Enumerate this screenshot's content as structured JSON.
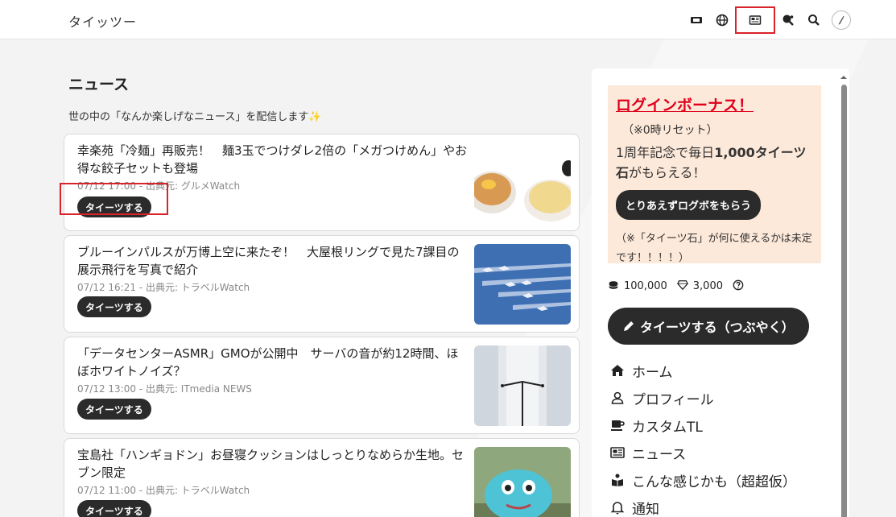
{
  "header": {
    "brand": "タイッツー",
    "icons": [
      "ticket-icon",
      "globe-icon",
      "newspaper-icon",
      "pingpong-icon",
      "search-icon",
      "avatar"
    ]
  },
  "main": {
    "title": "ニュース",
    "subtitle": "世の中の「なんか楽しげなニュース」を配信します✨",
    "articles": [
      {
        "title": "幸楽苑「冷麺」再販売！　麺3玉でつけダレ2倍の「メガつけめん」やお得な餃子セットも登場",
        "meta": "07/12 17:00 - 出典元: グルメWatch",
        "button": "タイーツする"
      },
      {
        "title": "ブルーインパルスが万博上空に来たぞ！　大屋根リングで見た7課目の展示飛行を写真で紹介",
        "meta": "07/12 16:21 - 出典元: トラベルWatch",
        "button": "タイーツする"
      },
      {
        "title": "「データセンターASMR」GMOが公開中　サーバの音が約12時間、ほぼホワイトノイズ？",
        "meta": "07/12 13:00 - 出典元: ITmedia NEWS",
        "button": "タイーツする"
      },
      {
        "title": "宝島社「ハンギョドン」お昼寝クッションはしっとりなめらか生地。セブン限定",
        "meta": "07/12 11:00 - 出典元: トラベルWatch",
        "button": "タイーツする"
      }
    ]
  },
  "sidebar": {
    "bonus": {
      "title": "ログインボーナス！",
      "note": "（※0時リセット）",
      "text_a": "1周年記念で毎日",
      "text_b": "1,000タイーツ石",
      "text_c": "がもらえる！",
      "button": "とりあえずログボをもらう",
      "foot": "（※「タイーツ石」が何に使えるかは未定です！！！！）"
    },
    "coins": "100,000",
    "gems": "3,000",
    "post_button": "タイーツする（つぶやく）",
    "nav": [
      {
        "label": "ホーム",
        "icon": "home-icon"
      },
      {
        "label": "プロフィール",
        "icon": "user-icon"
      },
      {
        "label": "カスタムTL",
        "icon": "mug-icon"
      },
      {
        "label": "ニュース",
        "icon": "newspaper-icon"
      },
      {
        "label": "こんな感じかも（超超仮）",
        "icon": "book-user-icon"
      },
      {
        "label": "通知",
        "icon": "bell-icon"
      }
    ]
  },
  "colors": {
    "accent_red": "#e0001b",
    "highlight": "#d9232a",
    "button_dark": "#2b2b2b",
    "bonus_bg": "#fde9d9"
  }
}
